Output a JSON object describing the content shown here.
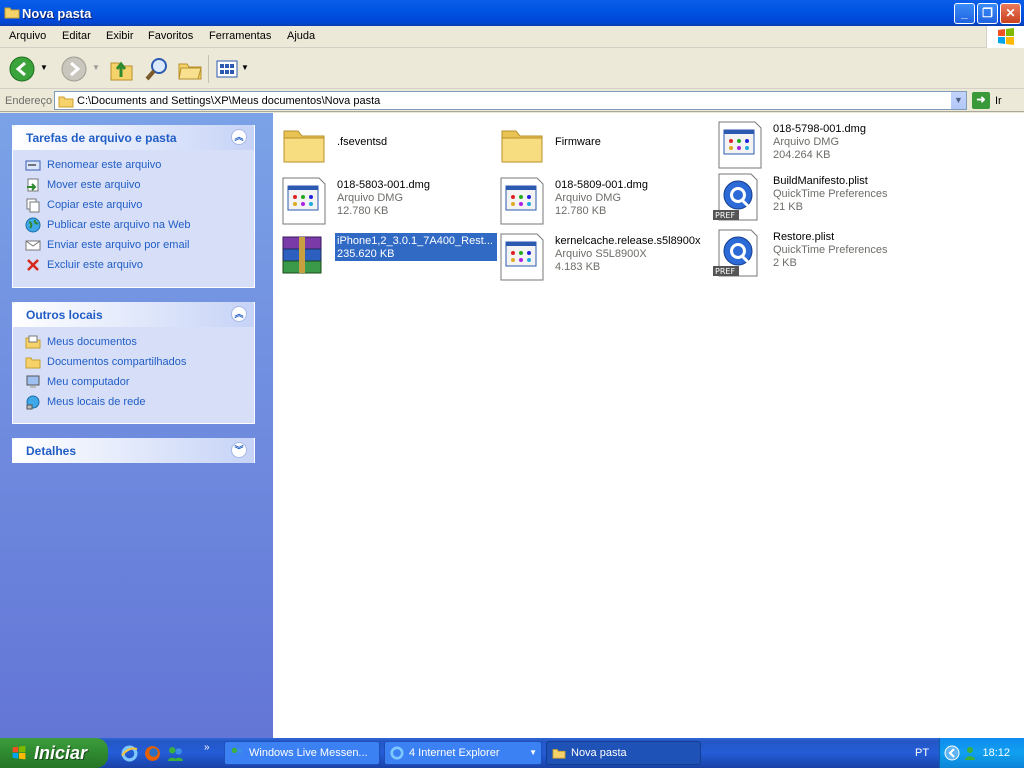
{
  "window": {
    "title": "Nova pasta"
  },
  "menu": [
    "Arquivo",
    "Editar",
    "Exibir",
    "Favoritos",
    "Ferramentas",
    "Ajuda"
  ],
  "address": {
    "label": "Endereço",
    "path": "C:\\Documents and Settings\\XP\\Meus documentos\\Nova pasta",
    "go_label": "Ir"
  },
  "tasks_panel": {
    "title": "Tarefas de arquivo e pasta",
    "items": [
      "Renomear este arquivo",
      "Mover este arquivo",
      "Copiar este arquivo",
      "Publicar este arquivo na Web",
      "Enviar este arquivo por email",
      "Excluir este arquivo"
    ]
  },
  "places_panel": {
    "title": "Outros locais",
    "items": [
      "Meus documentos",
      "Documentos compartilhados",
      "Meu computador",
      "Meus locais de rede"
    ]
  },
  "details_panel": {
    "title": "Detalhes"
  },
  "files": [
    {
      "name": ".fseventsd",
      "type": "",
      "size": "",
      "icon": "folder-icon"
    },
    {
      "name": "Firmware",
      "type": "",
      "size": "",
      "icon": "folder-icon"
    },
    {
      "name": "018-5798-001.dmg",
      "type": "Arquivo DMG",
      "size": "204.264 KB",
      "icon": "dmg-file-icon"
    },
    {
      "name": "018-5803-001.dmg",
      "type": "Arquivo DMG",
      "size": "12.780 KB",
      "icon": "dmg-file-icon"
    },
    {
      "name": "018-5809-001.dmg",
      "type": "Arquivo DMG",
      "size": "12.780 KB",
      "icon": "dmg-file-icon"
    },
    {
      "name": "BuildManifesto.plist",
      "type": "QuickTime Preferences",
      "size": "21 KB",
      "icon": "quicktime-pref-icon"
    },
    {
      "name": "iPhone1,2_3.0.1_7A400_Rest...",
      "type": "",
      "size": "235.620 KB",
      "icon": "winrar-archive-icon"
    },
    {
      "name": "kernelcache.release.s5l8900x",
      "type": "Arquivo S5L8900X",
      "size": "4.183 KB",
      "icon": "generic-file-icon"
    },
    {
      "name": "Restore.plist",
      "type": "QuickTime Preferences",
      "size": "2 KB",
      "icon": "quicktime-pref-icon"
    }
  ],
  "taskbar": {
    "start_label": "Iniciar",
    "tasks": [
      "Windows Live Messen...",
      "4 Internet Explorer",
      "Nova pasta"
    ],
    "lang": "PT",
    "clock": "18:12"
  }
}
